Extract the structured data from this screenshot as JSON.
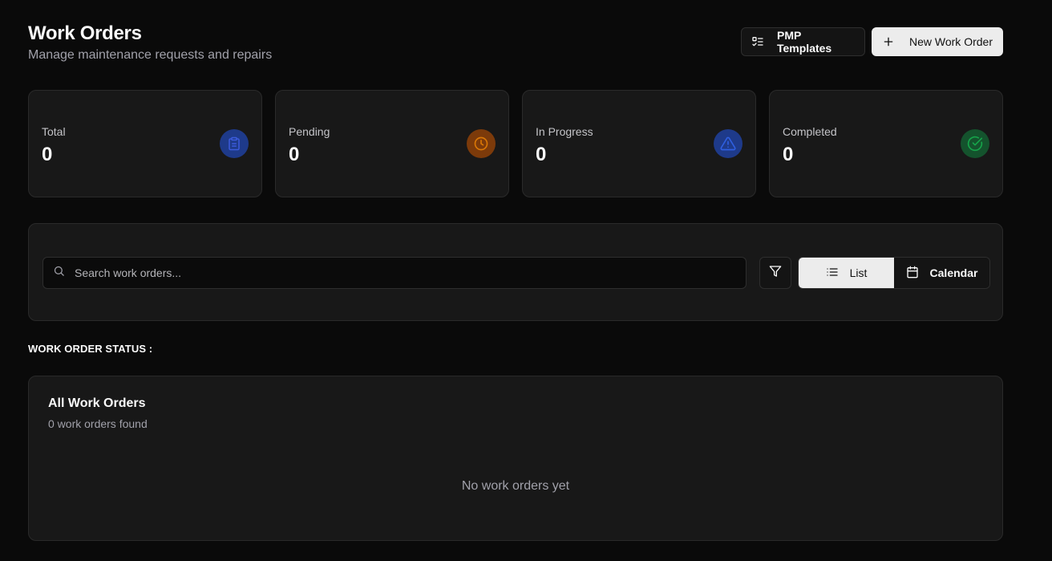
{
  "header": {
    "title": "Work Orders",
    "subtitle": "Manage maintenance requests and repairs",
    "pmp_templates_label": "PMP Templates",
    "new_work_order_label": "New Work Order"
  },
  "stats": [
    {
      "label": "Total",
      "value": "0",
      "icon": "clipboard-icon",
      "color": "#1e3a8a",
      "icon_color": "#3b5bdb"
    },
    {
      "label": "Pending",
      "value": "0",
      "icon": "clock-icon",
      "color": "#7c3a0a",
      "icon_color": "#d97706"
    },
    {
      "label": "In Progress",
      "value": "0",
      "icon": "alert-triangle-icon",
      "color": "#1e3a8a",
      "icon_color": "#2f5fe0"
    },
    {
      "label": "Completed",
      "value": "0",
      "icon": "check-circle-icon",
      "color": "#14532d",
      "icon_color": "#16a34a"
    }
  ],
  "toolbar": {
    "search_placeholder": "Search work orders...",
    "view_list_label": "List",
    "view_calendar_label": "Calendar",
    "active_view": "List"
  },
  "section": {
    "status_label": "WORK ORDER STATUS :"
  },
  "list": {
    "title": "All Work Orders",
    "count_text": "0 work orders found",
    "empty_text": "No work orders yet"
  }
}
